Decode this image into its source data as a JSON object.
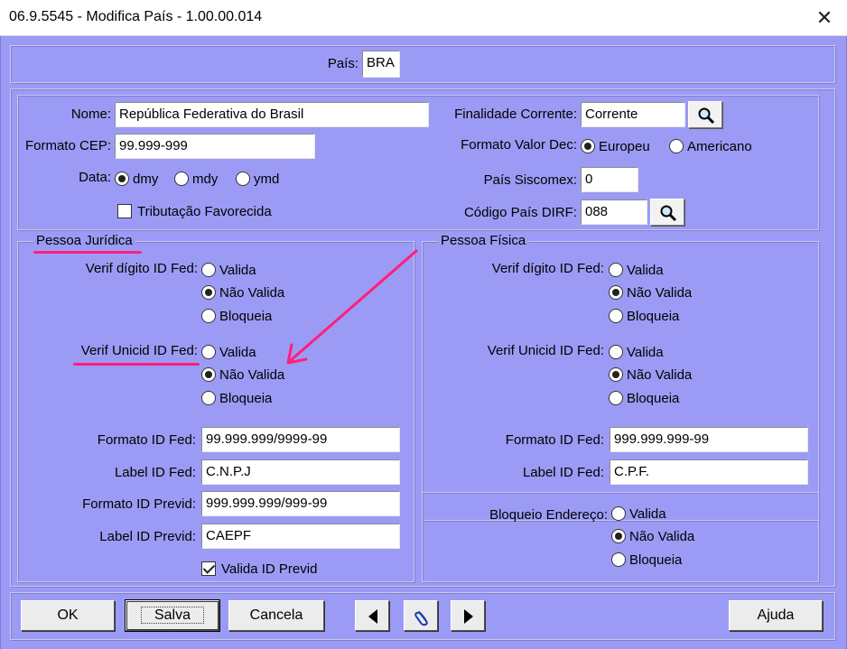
{
  "window": {
    "title": "06.9.5545 - Modifica País - 1.00.00.014",
    "close_glyph": "✕"
  },
  "pais": {
    "label": "País:",
    "value": "BRA"
  },
  "top": {
    "nome_label": "Nome:",
    "nome_value": "República Federativa do Brasil",
    "cep_label": "Formato CEP:",
    "cep_value": "99.999-999",
    "data_label": "Data:",
    "data_options": [
      "dmy",
      "mdy",
      "ymd"
    ],
    "data_selected": "dmy",
    "tributacao_label": "Tributação Favorecida",
    "tributacao_checked": false,
    "finalidade_label": "Finalidade Corrente:",
    "finalidade_value": "Corrente",
    "valor_dec_label": "Formato Valor Dec:",
    "valor_dec_options": [
      "Europeu",
      "Americano"
    ],
    "valor_dec_selected": "Europeu",
    "siscomex_label": "País Siscomex:",
    "siscomex_value": "0",
    "dirf_label": "Código País DIRF:",
    "dirf_value": "088"
  },
  "juridica": {
    "title": "Pessoa Jurídica",
    "verif_digito_label": "Verif dígito ID Fed:",
    "verif_digito_options": [
      "Valida",
      "Não Valida",
      "Bloqueia"
    ],
    "verif_digito_selected": "Não Valida",
    "verif_unicid_label": "Verif Unicid ID Fed:",
    "verif_unicid_options": [
      "Valida",
      "Não Valida",
      "Bloqueia"
    ],
    "verif_unicid_selected": "Não Valida",
    "formato_id_label": "Formato ID Fed:",
    "formato_id_value": "99.999.999/9999-99",
    "label_id_label": "Label ID Fed:",
    "label_id_value": "C.N.P.J",
    "formato_previd_label": "Formato ID Previd:",
    "formato_previd_value": "999.999.999/999-99",
    "label_previd_label": "Label ID Previd:",
    "label_previd_value": "CAEPF",
    "valida_previd_label": "Valida ID Previd",
    "valida_previd_checked": true
  },
  "fisica": {
    "title": "Pessoa Física",
    "verif_digito_label": "Verif dígito ID Fed:",
    "verif_digito_options": [
      "Valida",
      "Não Valida",
      "Bloqueia"
    ],
    "verif_digito_selected": "Não Valida",
    "verif_unicid_label": "Verif Unicid ID Fed:",
    "verif_unicid_options": [
      "Valida",
      "Não Valida",
      "Bloqueia"
    ],
    "verif_unicid_selected": "Não Valida",
    "formato_id_label": "Formato ID Fed:",
    "formato_id_value": "999.999.999-99",
    "label_id_label": "Label ID Fed:",
    "label_id_value": "C.P.F."
  },
  "bloqueio": {
    "label": "Bloqueio Endereço:",
    "options": [
      "Valida",
      "Não Valida",
      "Bloqueia"
    ],
    "selected": "Não Valida"
  },
  "buttons": {
    "ok": "OK",
    "salva": "Salva",
    "cancela": "Cancela",
    "ajuda": "Ajuda"
  },
  "icons": {
    "lookup": "magnifier-icon",
    "prev": "triangle-left-icon",
    "attach": "paperclip-icon",
    "next": "triangle-right-icon"
  },
  "colors": {
    "window_bg": "#9b9bf5",
    "annotation": "#ff1f7a"
  }
}
